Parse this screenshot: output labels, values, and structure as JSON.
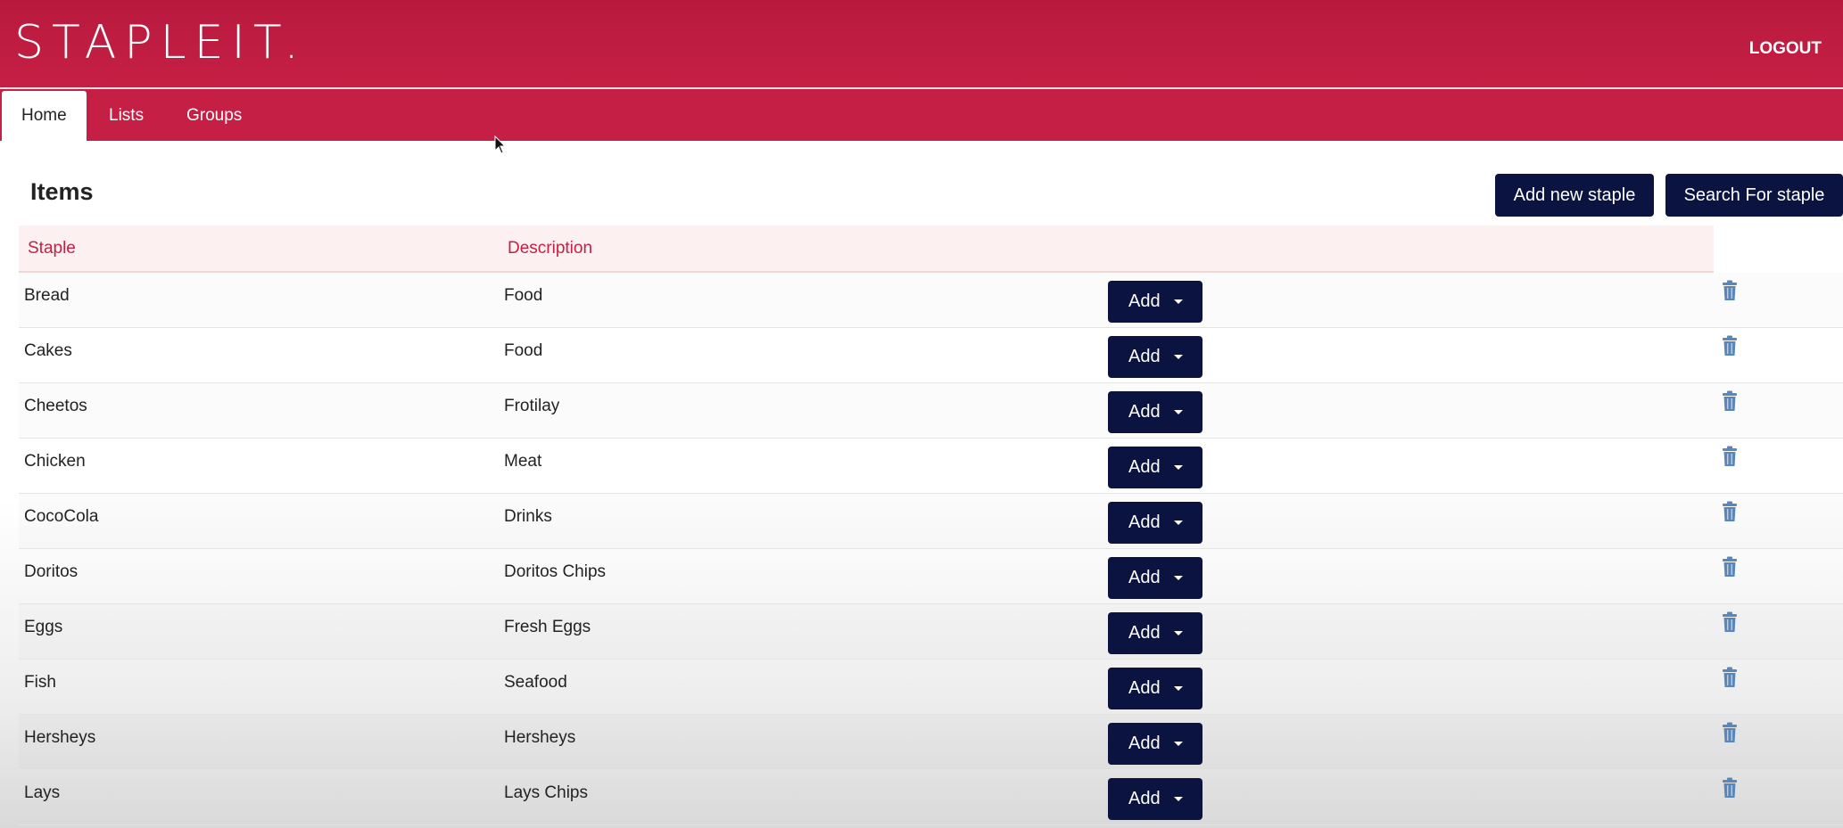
{
  "header": {
    "logo": "STAPLEIT.",
    "logout_label": "LOGOUT"
  },
  "nav": {
    "tabs": [
      {
        "label": "Home",
        "active": true
      },
      {
        "label": "Lists",
        "active": false
      },
      {
        "label": "Groups",
        "active": false
      }
    ]
  },
  "main": {
    "title": "Items",
    "add_new_label": "Add new staple",
    "search_label": "Search For staple",
    "table": {
      "columns": [
        "Staple",
        "Description"
      ],
      "rows": [
        {
          "staple": "Bread",
          "description": "Food"
        },
        {
          "staple": "Cakes",
          "description": "Food"
        },
        {
          "staple": "Cheetos",
          "description": "Frotilay"
        },
        {
          "staple": "Chicken",
          "description": "Meat"
        },
        {
          "staple": "CocoCola",
          "description": "Drinks"
        },
        {
          "staple": "Doritos",
          "description": "Doritos Chips"
        },
        {
          "staple": "Eggs",
          "description": "Fresh Eggs"
        },
        {
          "staple": "Fish",
          "description": "Seafood"
        },
        {
          "staple": "Hersheys",
          "description": "Hersheys"
        },
        {
          "staple": "Lays",
          "description": "Lays Chips"
        }
      ],
      "row_action_label": "Add"
    }
  },
  "icons": {
    "row_delete": "trash-icon",
    "row_action_caret": "caret-down-icon"
  },
  "colors": {
    "brand": "#c61f45",
    "button_dark": "#0b1340",
    "header_row_bg": "#fdf0f0",
    "delete_icon": "#5b86b8"
  }
}
